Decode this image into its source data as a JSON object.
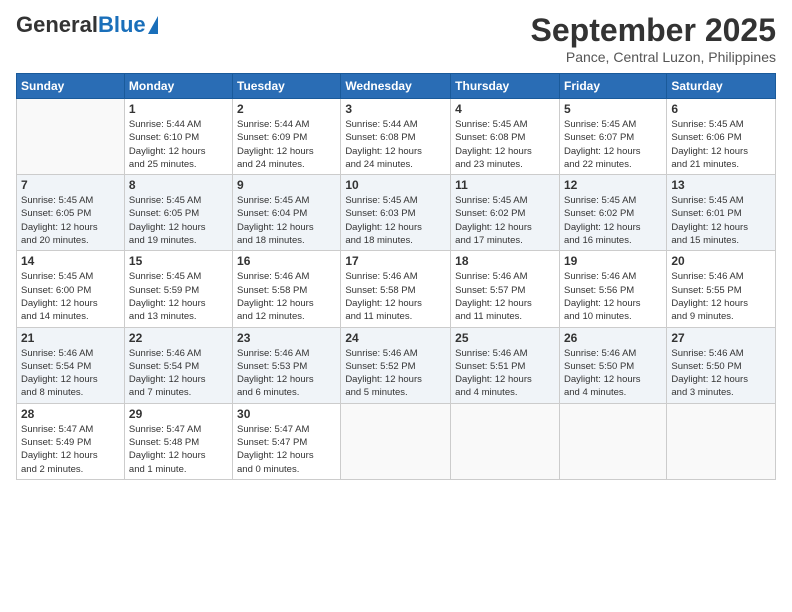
{
  "logo": {
    "general": "General",
    "blue": "Blue"
  },
  "header": {
    "month_title": "September 2025",
    "location": "Pance, Central Luzon, Philippines"
  },
  "weekdays": [
    "Sunday",
    "Monday",
    "Tuesday",
    "Wednesday",
    "Thursday",
    "Friday",
    "Saturday"
  ],
  "weeks": [
    [
      {
        "day": "",
        "info": ""
      },
      {
        "day": "1",
        "info": "Sunrise: 5:44 AM\nSunset: 6:10 PM\nDaylight: 12 hours\nand 25 minutes."
      },
      {
        "day": "2",
        "info": "Sunrise: 5:44 AM\nSunset: 6:09 PM\nDaylight: 12 hours\nand 24 minutes."
      },
      {
        "day": "3",
        "info": "Sunrise: 5:44 AM\nSunset: 6:08 PM\nDaylight: 12 hours\nand 24 minutes."
      },
      {
        "day": "4",
        "info": "Sunrise: 5:45 AM\nSunset: 6:08 PM\nDaylight: 12 hours\nand 23 minutes."
      },
      {
        "day": "5",
        "info": "Sunrise: 5:45 AM\nSunset: 6:07 PM\nDaylight: 12 hours\nand 22 minutes."
      },
      {
        "day": "6",
        "info": "Sunrise: 5:45 AM\nSunset: 6:06 PM\nDaylight: 12 hours\nand 21 minutes."
      }
    ],
    [
      {
        "day": "7",
        "info": "Sunrise: 5:45 AM\nSunset: 6:05 PM\nDaylight: 12 hours\nand 20 minutes."
      },
      {
        "day": "8",
        "info": "Sunrise: 5:45 AM\nSunset: 6:05 PM\nDaylight: 12 hours\nand 19 minutes."
      },
      {
        "day": "9",
        "info": "Sunrise: 5:45 AM\nSunset: 6:04 PM\nDaylight: 12 hours\nand 18 minutes."
      },
      {
        "day": "10",
        "info": "Sunrise: 5:45 AM\nSunset: 6:03 PM\nDaylight: 12 hours\nand 18 minutes."
      },
      {
        "day": "11",
        "info": "Sunrise: 5:45 AM\nSunset: 6:02 PM\nDaylight: 12 hours\nand 17 minutes."
      },
      {
        "day": "12",
        "info": "Sunrise: 5:45 AM\nSunset: 6:02 PM\nDaylight: 12 hours\nand 16 minutes."
      },
      {
        "day": "13",
        "info": "Sunrise: 5:45 AM\nSunset: 6:01 PM\nDaylight: 12 hours\nand 15 minutes."
      }
    ],
    [
      {
        "day": "14",
        "info": "Sunrise: 5:45 AM\nSunset: 6:00 PM\nDaylight: 12 hours\nand 14 minutes."
      },
      {
        "day": "15",
        "info": "Sunrise: 5:45 AM\nSunset: 5:59 PM\nDaylight: 12 hours\nand 13 minutes."
      },
      {
        "day": "16",
        "info": "Sunrise: 5:46 AM\nSunset: 5:58 PM\nDaylight: 12 hours\nand 12 minutes."
      },
      {
        "day": "17",
        "info": "Sunrise: 5:46 AM\nSunset: 5:58 PM\nDaylight: 12 hours\nand 11 minutes."
      },
      {
        "day": "18",
        "info": "Sunrise: 5:46 AM\nSunset: 5:57 PM\nDaylight: 12 hours\nand 11 minutes."
      },
      {
        "day": "19",
        "info": "Sunrise: 5:46 AM\nSunset: 5:56 PM\nDaylight: 12 hours\nand 10 minutes."
      },
      {
        "day": "20",
        "info": "Sunrise: 5:46 AM\nSunset: 5:55 PM\nDaylight: 12 hours\nand 9 minutes."
      }
    ],
    [
      {
        "day": "21",
        "info": "Sunrise: 5:46 AM\nSunset: 5:54 PM\nDaylight: 12 hours\nand 8 minutes."
      },
      {
        "day": "22",
        "info": "Sunrise: 5:46 AM\nSunset: 5:54 PM\nDaylight: 12 hours\nand 7 minutes."
      },
      {
        "day": "23",
        "info": "Sunrise: 5:46 AM\nSunset: 5:53 PM\nDaylight: 12 hours\nand 6 minutes."
      },
      {
        "day": "24",
        "info": "Sunrise: 5:46 AM\nSunset: 5:52 PM\nDaylight: 12 hours\nand 5 minutes."
      },
      {
        "day": "25",
        "info": "Sunrise: 5:46 AM\nSunset: 5:51 PM\nDaylight: 12 hours\nand 4 minutes."
      },
      {
        "day": "26",
        "info": "Sunrise: 5:46 AM\nSunset: 5:50 PM\nDaylight: 12 hours\nand 4 minutes."
      },
      {
        "day": "27",
        "info": "Sunrise: 5:46 AM\nSunset: 5:50 PM\nDaylight: 12 hours\nand 3 minutes."
      }
    ],
    [
      {
        "day": "28",
        "info": "Sunrise: 5:47 AM\nSunset: 5:49 PM\nDaylight: 12 hours\nand 2 minutes."
      },
      {
        "day": "29",
        "info": "Sunrise: 5:47 AM\nSunset: 5:48 PM\nDaylight: 12 hours\nand 1 minute."
      },
      {
        "day": "30",
        "info": "Sunrise: 5:47 AM\nSunset: 5:47 PM\nDaylight: 12 hours\nand 0 minutes."
      },
      {
        "day": "",
        "info": ""
      },
      {
        "day": "",
        "info": ""
      },
      {
        "day": "",
        "info": ""
      },
      {
        "day": "",
        "info": ""
      }
    ]
  ]
}
